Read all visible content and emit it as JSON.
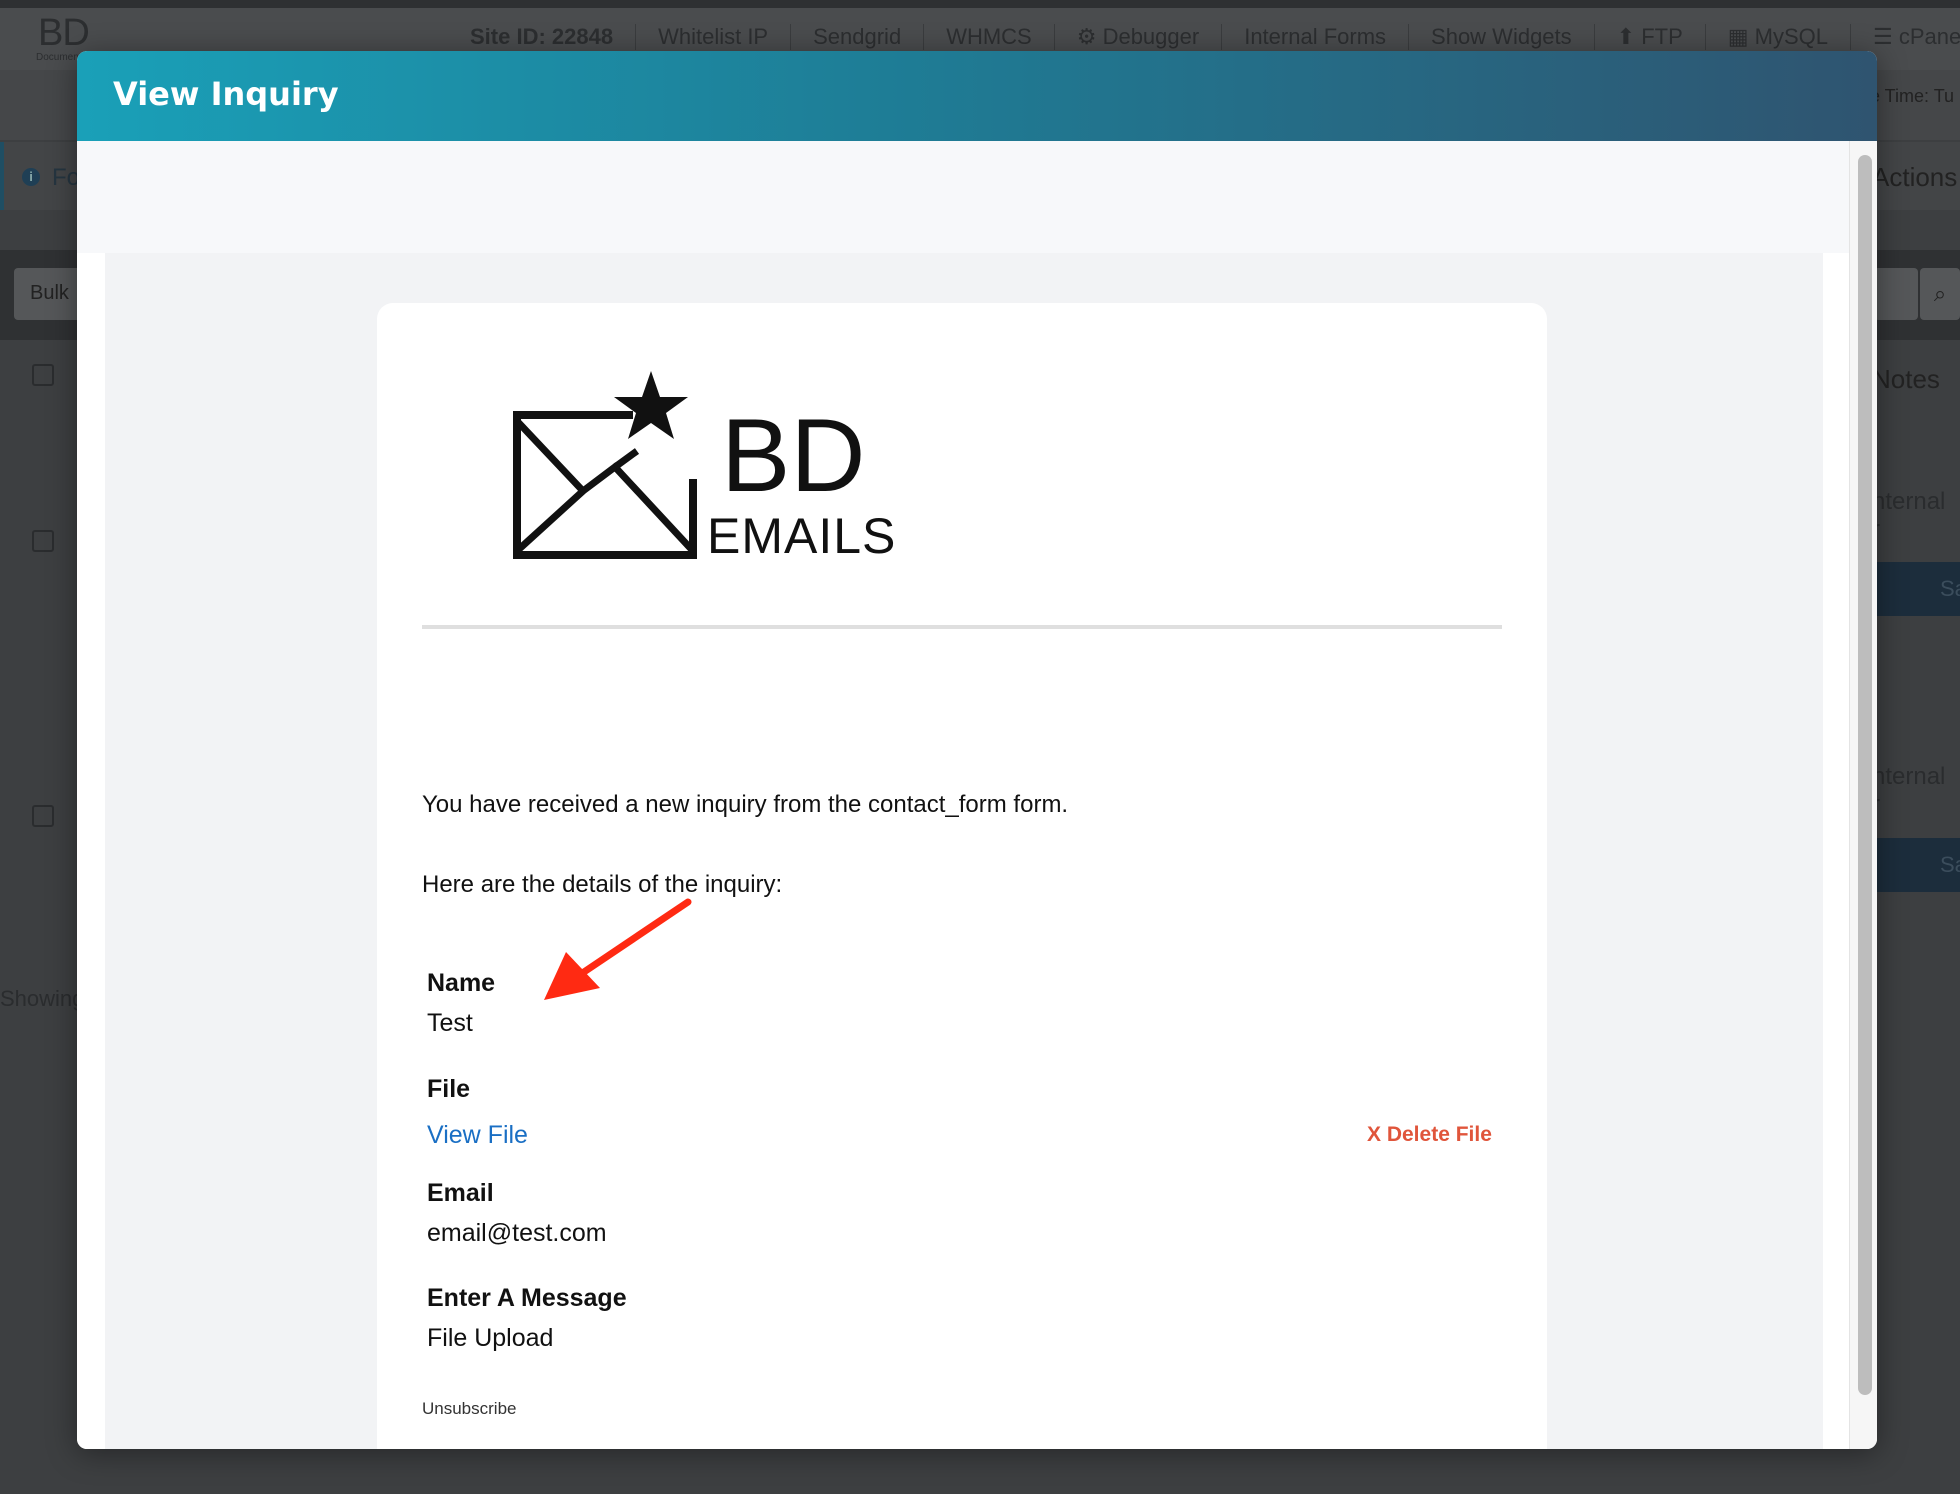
{
  "background": {
    "logo_text": "BD",
    "logo_sub": "Documentation",
    "nav": {
      "site_id": "Site ID: 22848",
      "items": [
        "Whitelist IP",
        "Sendgrid",
        "WHMCS",
        "⚙ Debugger",
        "Internal Forms",
        "Show Widgets",
        "⬆ FTP",
        "▦ MySQL",
        "☰ cPanel"
      ]
    },
    "time_label": "e Time: Tu",
    "info_text": "Fo",
    "actions_label": "Actions",
    "bulk_label": "Bulk",
    "notes_label": "Notes",
    "internal_label": "nternal r",
    "s_button": "Sa",
    "showing_label": "Showing"
  },
  "modal": {
    "title": "View Inquiry"
  },
  "email": {
    "logo": {
      "brand": "BD",
      "sub": "EMAILS",
      "icon": "envelope-star-icon"
    },
    "intro_line_1": "You have received a new inquiry from the contact_form form.",
    "intro_line_2": "Here are the details of the inquiry:",
    "fields": {
      "name_label": "Name",
      "name_value": "Test",
      "file_label": "File",
      "file_link": "View File",
      "delete_file": "X Delete File",
      "email_label": "Email",
      "email_value": "email@test.com",
      "message_label": "Enter A Message",
      "message_value": "File Upload"
    },
    "unsubscribe": "Unsubscribe"
  },
  "annotation": {
    "arrow_color": "#ff2a12",
    "arrow_icon": "arrow-pointer-icon"
  },
  "colors": {
    "header_start": "#1aa0b8",
    "header_end": "#2f5470",
    "link": "#1a6fc4",
    "delete": "#e0553b"
  }
}
